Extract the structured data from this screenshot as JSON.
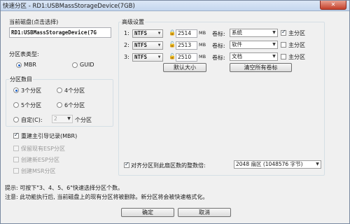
{
  "window": {
    "title": "快速分区 - RD1:USBMassStorageDevice(7GB)",
    "close_label": "✕"
  },
  "current_disk": {
    "label": "当前磁盘(点击选择)",
    "value": "RD1:USBMassStorageDevice(7G"
  },
  "partition_table": {
    "label": "分区表类型:",
    "options": [
      "MBR",
      "GUID"
    ],
    "selected": "MBR"
  },
  "partition_count": {
    "label": "分区数目",
    "options": [
      "3个分区",
      "4个分区",
      "5个分区",
      "6个分区"
    ],
    "selected": "3个分区",
    "custom_label": "自定(C):",
    "custom_value": "2",
    "custom_suffix": "个分区"
  },
  "mbr": {
    "label": "重建主引导记录(MBR)",
    "checked": true
  },
  "esp": {
    "keep": "保留现有ESP分区",
    "create_esp": "创建新ESP分区",
    "create_msr": "创建MSR分区"
  },
  "advanced": {
    "label": "高级设置",
    "size_unit": "MB",
    "volume_label": "卷标:",
    "primary_label": "主分区",
    "rows": [
      {
        "index": "1:",
        "fs": "NTFS",
        "size": "2514",
        "locked": true,
        "volume": "系统",
        "primary": true
      },
      {
        "index": "2:",
        "fs": "NTFS",
        "size": "2513",
        "locked": false,
        "volume": "软件",
        "primary": false
      },
      {
        "index": "3:",
        "fs": "NTFS",
        "size": "2510",
        "locked": false,
        "volume": "文档",
        "primary": false
      }
    ],
    "default_size_button": "默认大小",
    "clear_labels_button": "清空所有卷标"
  },
  "align": {
    "label": "对齐分区到此扇区数的整数倍:",
    "checked": true,
    "value": "2048 扇区 (1048576 字节)"
  },
  "hint": {
    "line1": "提示: 可按下\"3、4、5、6\"快速选择分区个数。",
    "line2": "注意: 此功能执行后, 当前磁盘上的现有分区将被删除。新分区将会被快速格式化。"
  },
  "buttons": {
    "ok": "确定",
    "cancel": "取消"
  },
  "icons": {
    "dropdown": "chevron-down-icon",
    "lock": "lock-icon",
    "unlock": "unlock-icon"
  }
}
